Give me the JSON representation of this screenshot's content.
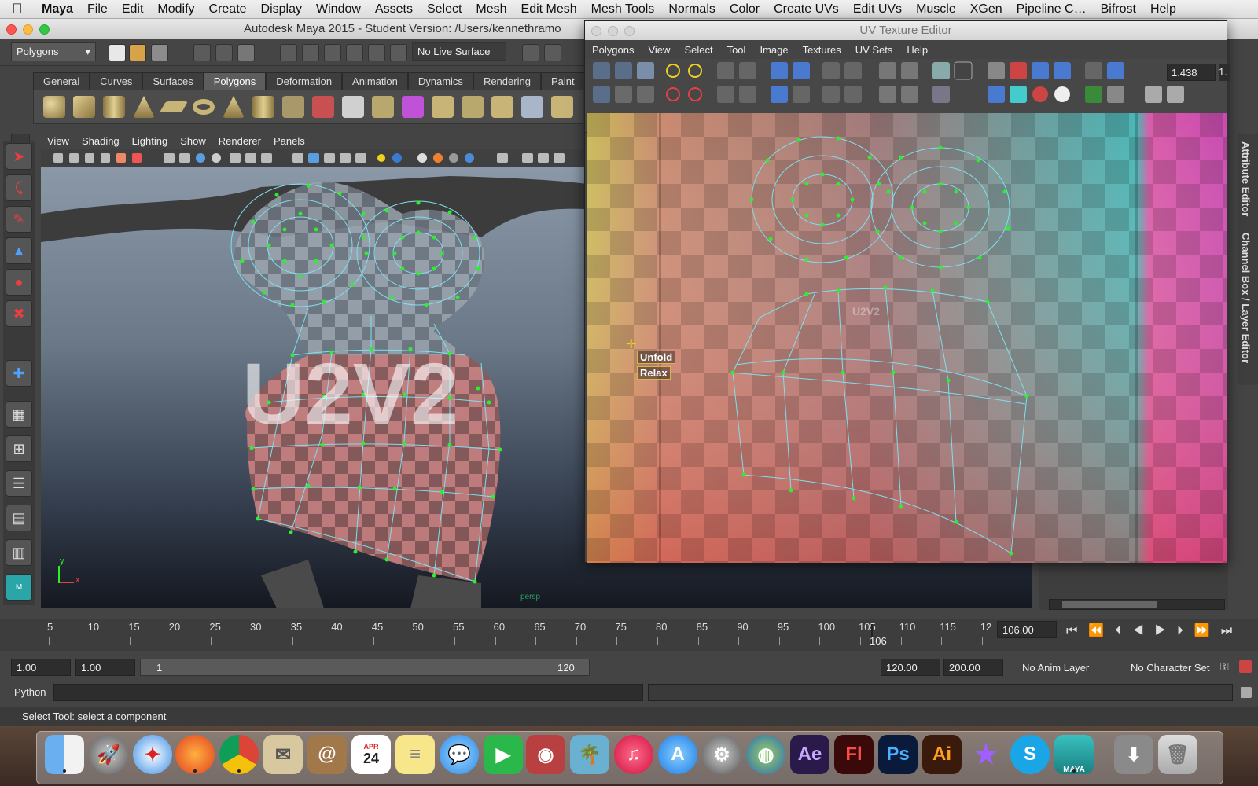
{
  "menubar": {
    "apple": "",
    "items": [
      "Maya",
      "File",
      "Edit",
      "Modify",
      "Create",
      "Display",
      "Window",
      "Assets",
      "Select",
      "Mesh",
      "Edit Mesh",
      "Mesh Tools",
      "Normals",
      "Color",
      "Create UVs",
      "Edit UVs",
      "Muscle",
      "XGen",
      "Pipeline C…",
      "Bifrost",
      "Help"
    ]
  },
  "main_window": {
    "title": "Autodesk Maya 2015 - Student Version: /Users/kennethramo"
  },
  "status_line": {
    "mode": "Polygons",
    "live_surface": "No Live Surface"
  },
  "shelf": {
    "tabs": [
      "General",
      "Curves",
      "Surfaces",
      "Polygons",
      "Deformation",
      "Animation",
      "Dynamics",
      "Rendering",
      "Paint"
    ],
    "active_tab": "Polygons"
  },
  "viewport": {
    "menu": [
      "View",
      "Shading",
      "Lighting",
      "Show",
      "Renderer",
      "Panels"
    ],
    "camera_label": "persp",
    "axis_y": "y",
    "axis_x": "x",
    "texture_text": "U2V2"
  },
  "uv_editor": {
    "title": "UV Texture Editor",
    "menu": [
      "Polygons",
      "View",
      "Select",
      "Tool",
      "Image",
      "Textures",
      "UV Sets",
      "Help"
    ],
    "zoom_value": "1.438",
    "zoom_value_2": "1.",
    "marking_menu": [
      "Unfold",
      "Relax"
    ],
    "texture_text": "U2V2"
  },
  "side_tabs": [
    "Attribute Editor",
    "Channel Box / Layer Editor"
  ],
  "timeline": {
    "ticks": [
      "5",
      "10",
      "15",
      "20",
      "25",
      "30",
      "35",
      "40",
      "45",
      "50",
      "55",
      "60",
      "65",
      "70",
      "75",
      "80",
      "85",
      "90",
      "95",
      "100",
      "105",
      "110",
      "115",
      "12"
    ],
    "current_marker": "106",
    "current_frame": "106.00"
  },
  "range": {
    "start": "1.00",
    "start_inner": "1.00",
    "slider_start": "1",
    "slider_end": "120",
    "end": "120.00",
    "end_outer": "200.00",
    "anim_layer": "No Anim Layer",
    "character_set": "No Character Set"
  },
  "command_line": {
    "language": "Python"
  },
  "help_line": {
    "text": "Select Tool: select a component"
  },
  "dock": {
    "calendar_month": "APR",
    "calendar_day": "24",
    "labels": {
      "ae": "Ae",
      "fl": "Fl",
      "ps": "Ps",
      "ai": "Ai",
      "maya": "MAYA"
    }
  },
  "colors": {
    "wire": "#7ee0ee",
    "vertex": "#2cf02c",
    "accent": "#5d5d5d"
  }
}
